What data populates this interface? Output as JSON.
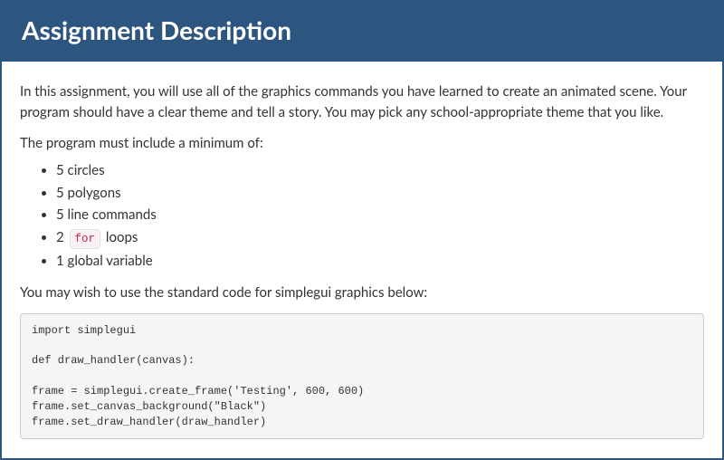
{
  "header": {
    "title": "Assignment Description"
  },
  "content": {
    "intro": "In this assignment, you will use all of the graphics commands you have learned to create an animated scene. Your program should have a clear theme and tell a story. You may pick any school-appropriate theme that you like.",
    "leadIn": "The program must include a minimum of:",
    "requirements": [
      {
        "text": "5 circles"
      },
      {
        "text": "5 polygons"
      },
      {
        "text": "5 line commands"
      },
      {
        "prefix": "2 ",
        "code": "for",
        "suffix": " loops"
      },
      {
        "text": "1 global variable"
      }
    ],
    "afterText": "You may wish to use the standard code for simplegui graphics below:",
    "codeBlock": "import simplegui\n\ndef draw_handler(canvas):\n\nframe = simplegui.create_frame('Testing', 600, 600)\nframe.set_canvas_background(\"Black\")\nframe.set_draw_handler(draw_handler)"
  }
}
